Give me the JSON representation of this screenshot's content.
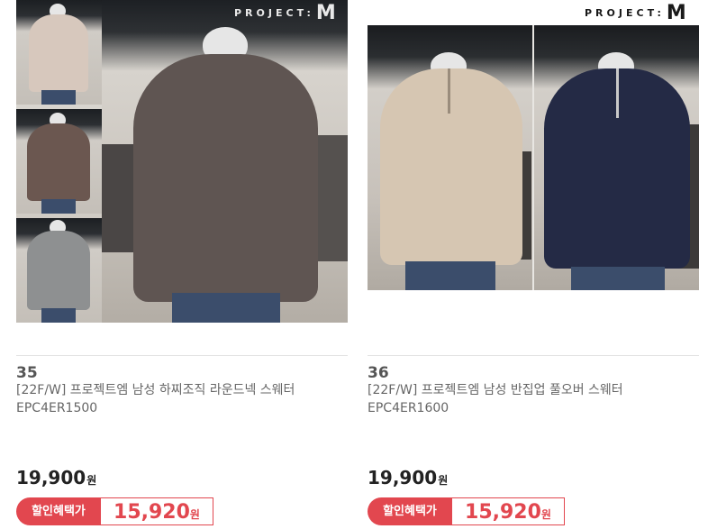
{
  "products": [
    {
      "number": "35",
      "brand_logo": "PROJECT:M",
      "title": "[22F/W] 프로젝트엠 남성 하찌조직 라운드넥 스웨터 EPC4ER1500",
      "price": "19,900",
      "price_unit": "원",
      "deal_label": "할인혜택가",
      "deal_price": "15,920",
      "deal_unit": "원",
      "colors": {
        "main_sweater": "#5f5552",
        "tile1": "#d7c8bd",
        "tile2": "#6b5750",
        "tile3": "#8e9091"
      }
    },
    {
      "number": "36",
      "brand_logo": "PROJECT:M",
      "title": "[22F/W] 프로젝트엠 남성 반집업 풀오버 스웨터 EPC4ER1600",
      "price": "19,900",
      "price_unit": "원",
      "deal_label": "할인혜택가",
      "deal_price": "15,920",
      "deal_unit": "원",
      "colors": {
        "sweater_left": "#d6c6b2",
        "sweater_right": "#242a45"
      }
    }
  ],
  "accent_color": "#e2474f"
}
